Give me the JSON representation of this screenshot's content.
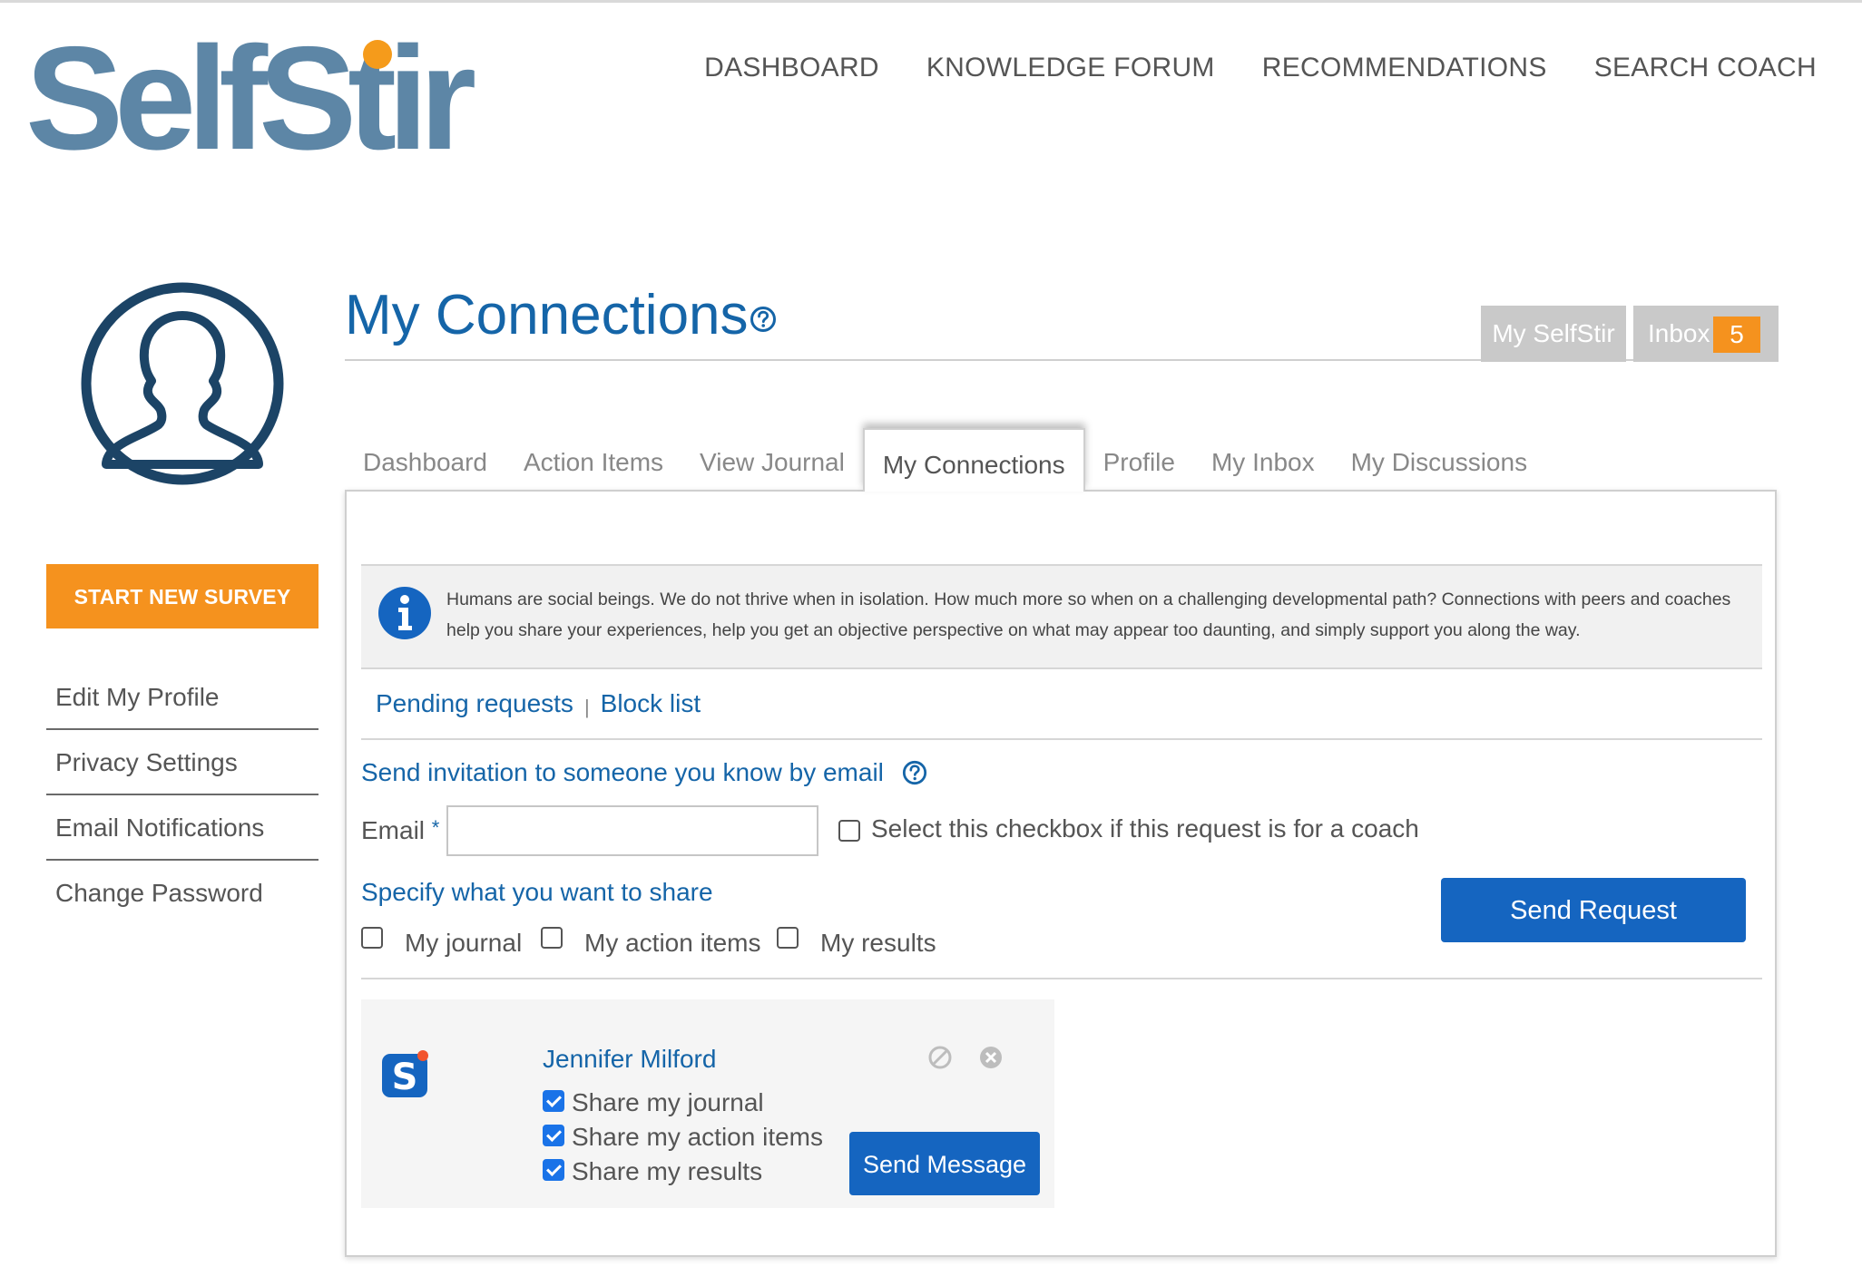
{
  "brand": {
    "logo_text": "SelfStir",
    "logo_color": "#5d86a6",
    "dot_color": "#f59b1b"
  },
  "top_nav": [
    {
      "label": "DASHBOARD"
    },
    {
      "label": "KNOWLEDGE FORUM"
    },
    {
      "label": "RECOMMENDATIONS"
    },
    {
      "label": "SEARCH COACH"
    }
  ],
  "sidebar": {
    "avatar_icon": "user-silhouette-icon",
    "survey_button": "START NEW SURVEY",
    "menu": [
      {
        "label": "Edit My Profile"
      },
      {
        "label": "Privacy Settings"
      },
      {
        "label": "Email Notifications"
      },
      {
        "label": "Change Password"
      }
    ]
  },
  "header": {
    "title": "My Connections",
    "my_selfstir": "My SelfStir",
    "inbox_label": "Inbox",
    "inbox_count": "5"
  },
  "tabs": [
    {
      "label": "Dashboard",
      "active": false
    },
    {
      "label": "Action Items",
      "active": false
    },
    {
      "label": "View Journal",
      "active": false
    },
    {
      "label": "My Connections",
      "active": true
    },
    {
      "label": "Profile",
      "active": false
    },
    {
      "label": "My Inbox",
      "active": false
    },
    {
      "label": "My Discussions",
      "active": false
    }
  ],
  "info": {
    "text": "Humans are social beings. We do not thrive when in isolation. How much more so when on a challenging developmental path? Connections with peers and coaches help you share your experiences, help you get an objective perspective on what may appear too daunting, and simply support you along the way."
  },
  "requests": {
    "pending": "Pending requests",
    "separator": "|",
    "block_list": "Block list"
  },
  "invite": {
    "title": "Send invitation to someone you know by email",
    "email_label": "Email",
    "required_mark": "*",
    "email_value": "",
    "email_placeholder": "",
    "coach_checkbox_label": "Select this checkbox if this request is for a coach",
    "share_title": "Specify what you want to share",
    "share_options": [
      {
        "label": "My journal",
        "checked": false
      },
      {
        "label": "My action items",
        "checked": false
      },
      {
        "label": "My results",
        "checked": false
      }
    ],
    "send_button": "Send Request"
  },
  "connection": {
    "name": "Jennifer Milford",
    "permissions": [
      {
        "label": "Share my journal",
        "checked": true
      },
      {
        "label": "Share my action items",
        "checked": true
      },
      {
        "label": "Share my results",
        "checked": true
      }
    ],
    "message_button": "Send Message"
  },
  "colors": {
    "primary_blue": "#1565a8",
    "button_blue": "#1565c0",
    "accent_orange": "#f5921e"
  }
}
